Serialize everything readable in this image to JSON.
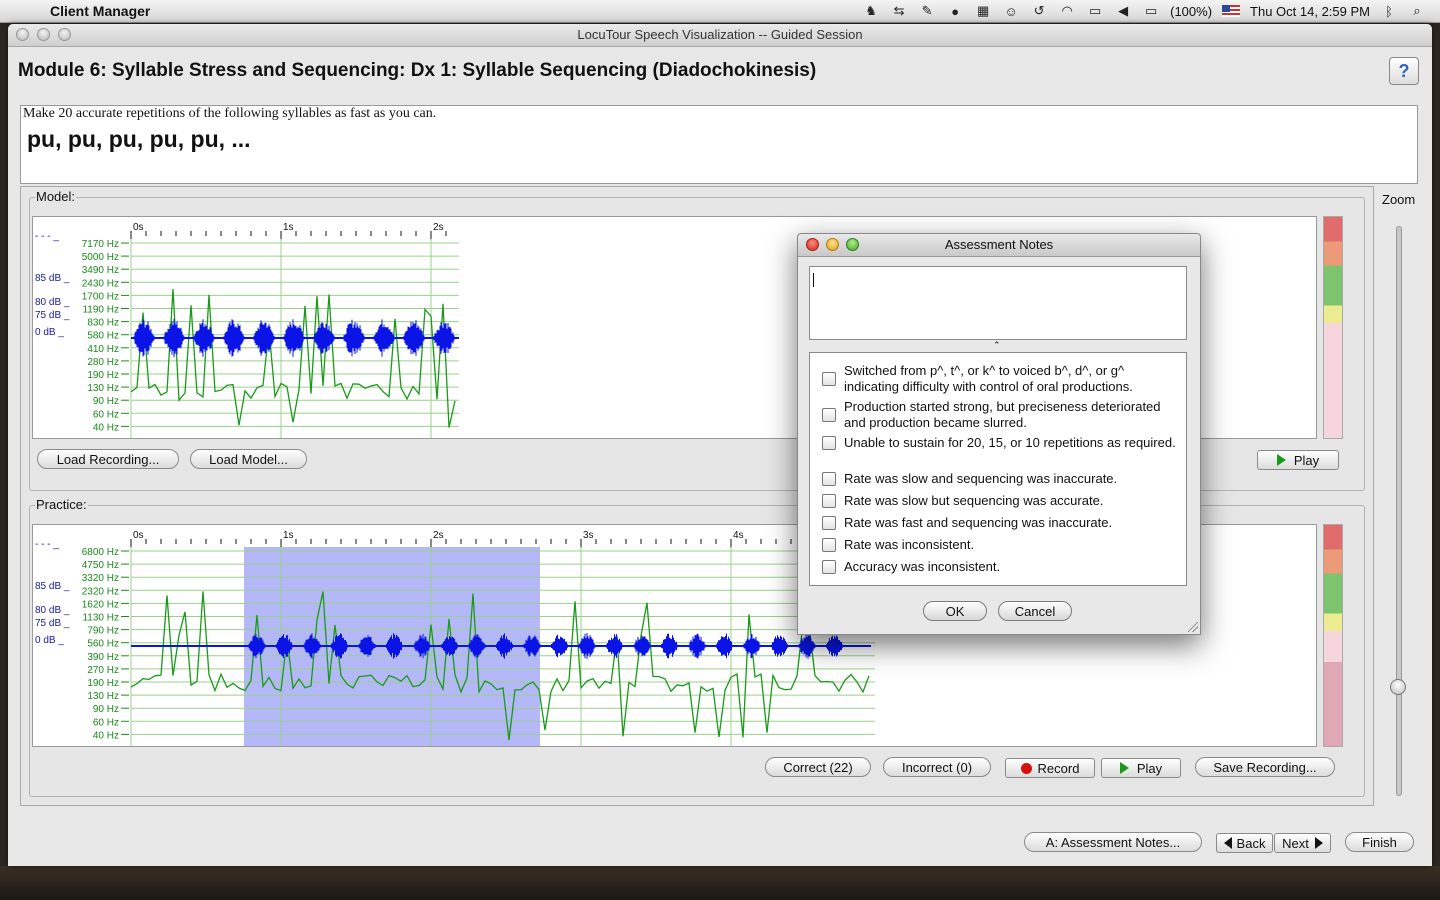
{
  "menubar": {
    "app_name": "Client Manager",
    "battery": "(100%)",
    "datetime": "Thu Oct 14,  2:59 PM"
  },
  "window": {
    "title": "LocuTour Speech Visualization -- Guided Session",
    "module_title": "Module 6: Syllable Stress and Sequencing: Dx 1: Syllable Sequencing (Diadochokinesis)",
    "help": "?"
  },
  "instructions": {
    "text": "Make 20 accurate repetitions of the following syllables as fast as you can.",
    "syllables": "pu, pu, pu, pu, pu, ..."
  },
  "model": {
    "label": "Model:",
    "load_recording": "Load Recording...",
    "load_model": "Load Model...",
    "play": "Play",
    "time_ticks": [
      "0s",
      "1s",
      "2s"
    ],
    "freq_labels": [
      "7170 Hz",
      "5000 Hz",
      "3490 Hz",
      "2430 Hz",
      "1700 Hz",
      "1190 Hz",
      "830 Hz",
      "580 Hz",
      "410 Hz",
      "280 Hz",
      "190 Hz",
      "130 Hz",
      "90 Hz",
      "60 Hz",
      "40 Hz"
    ]
  },
  "practice": {
    "label": "Practice:",
    "correct": "Correct (22)",
    "incorrect": "Incorrect (0)",
    "record": "Record",
    "play": "Play",
    "save_recording": "Save Recording...",
    "time_ticks": [
      "0s",
      "1s",
      "2s",
      "3s",
      "4s"
    ],
    "freq_labels": [
      "6800 Hz",
      "4750 Hz",
      "3320 Hz",
      "2320 Hz",
      "1620 Hz",
      "1130 Hz",
      "790 Hz",
      "560 Hz",
      "390 Hz",
      "270 Hz",
      "190 Hz",
      "130 Hz",
      "90 Hz",
      "60 Hz",
      "40 Hz"
    ]
  },
  "db_labels": [
    "85 dB",
    "80 dB",
    "75 dB",
    "0 dB"
  ],
  "zoom_label": "Zoom",
  "nav": {
    "assessment_notes": "A: Assessment Notes...",
    "back": "Back",
    "next": "Next",
    "finish": "Finish"
  },
  "dialog": {
    "title": "Assessment Notes",
    "notes_value": "",
    "items": [
      "Switched from p^, t^, or k^ to voiced b^, d^, or g^ indicating difficulty with control of oral productions.",
      "Production started strong, but preciseness deteriorated and production became slurred.",
      "Unable to sustain for 20, 15, or 10 repetitions as required.",
      "Rate was slow and sequencing was inaccurate.",
      "Rate was slow but sequencing was accurate.",
      "Rate was fast and sequencing was inaccurate.",
      "Rate was inconsistent.",
      "Accuracy was inconsistent."
    ],
    "ok": "OK",
    "cancel": "Cancel"
  },
  "colors": {
    "waveform": "#0a14e6",
    "pitch_trace": "#1a9a1a",
    "selection": "#b4b8f8",
    "axis_text": "#1a8a1a",
    "db_text": "#1a1aa0"
  }
}
